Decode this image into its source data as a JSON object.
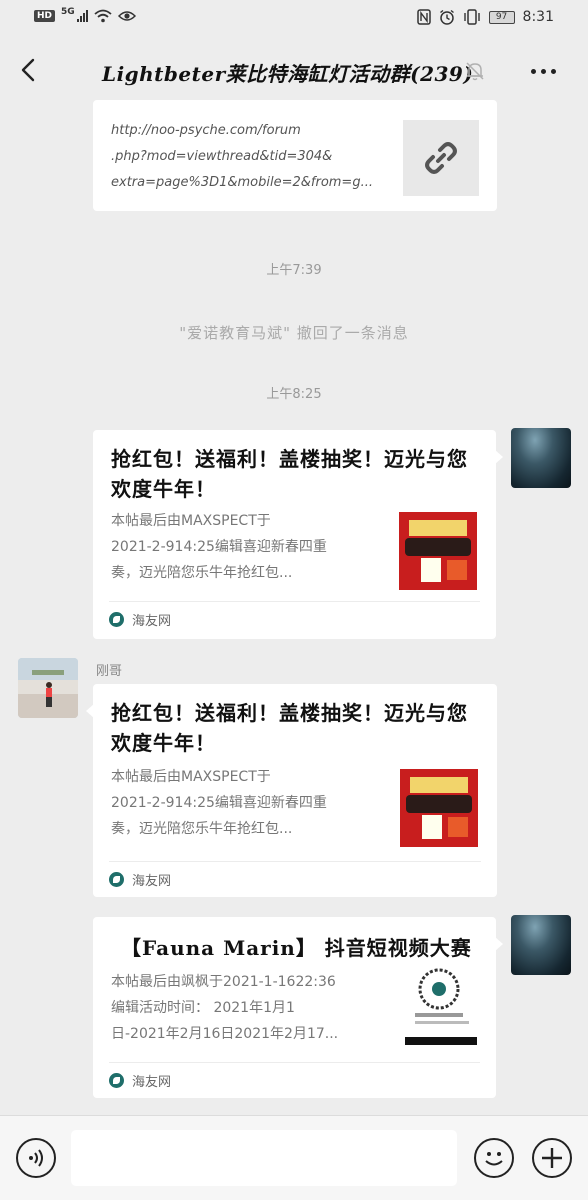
{
  "status_bar": {
    "hd": "HD",
    "network": "5G",
    "battery": "97",
    "time": "8:31"
  },
  "header": {
    "title": "Lightbeter莱比特海缸灯活动群(239)"
  },
  "messages": {
    "link": {
      "lines": [
        "http://noo-psyche.com/forum",
        ".php?mod=viewthread&tid=304&",
        "extra=page%3D1&mobile=2&from=g..."
      ]
    },
    "time1": "上午7:39",
    "recall": "\"爱诺教育马斌\" 撤回了一条消息",
    "time2": "上午8:25",
    "share1": {
      "title": "抢红包！送福利！盖楼抽奖！迈光与您欢度牛年！",
      "desc": [
        "本帖最后由MAXSPECT于",
        "2021-2-914:25编辑喜迎新春四重",
        "奏，迈光陪您乐牛年抢红包..."
      ],
      "source": "海友网"
    },
    "sender2": "刚哥",
    "share2": {
      "title": "抢红包！送福利！盖楼抽奖！迈光与您欢度牛年！",
      "desc": [
        "本帖最后由MAXSPECT于",
        "2021-2-914:25编辑喜迎新春四重",
        "奏，迈光陪您乐牛年抢红包..."
      ],
      "source": "海友网"
    },
    "share3": {
      "title": "【Fauna Marin】 抖音短视频大赛",
      "desc": [
        "本帖最后由飒枫于2021-1-1622:36",
        "编辑活动时间： 2021年1月1",
        "日-2021年2月16日2021年2月17..."
      ],
      "source": "海友网"
    }
  },
  "colors": {
    "background": "#ededed",
    "bubble": "#ffffff",
    "time_text": "#999999"
  }
}
